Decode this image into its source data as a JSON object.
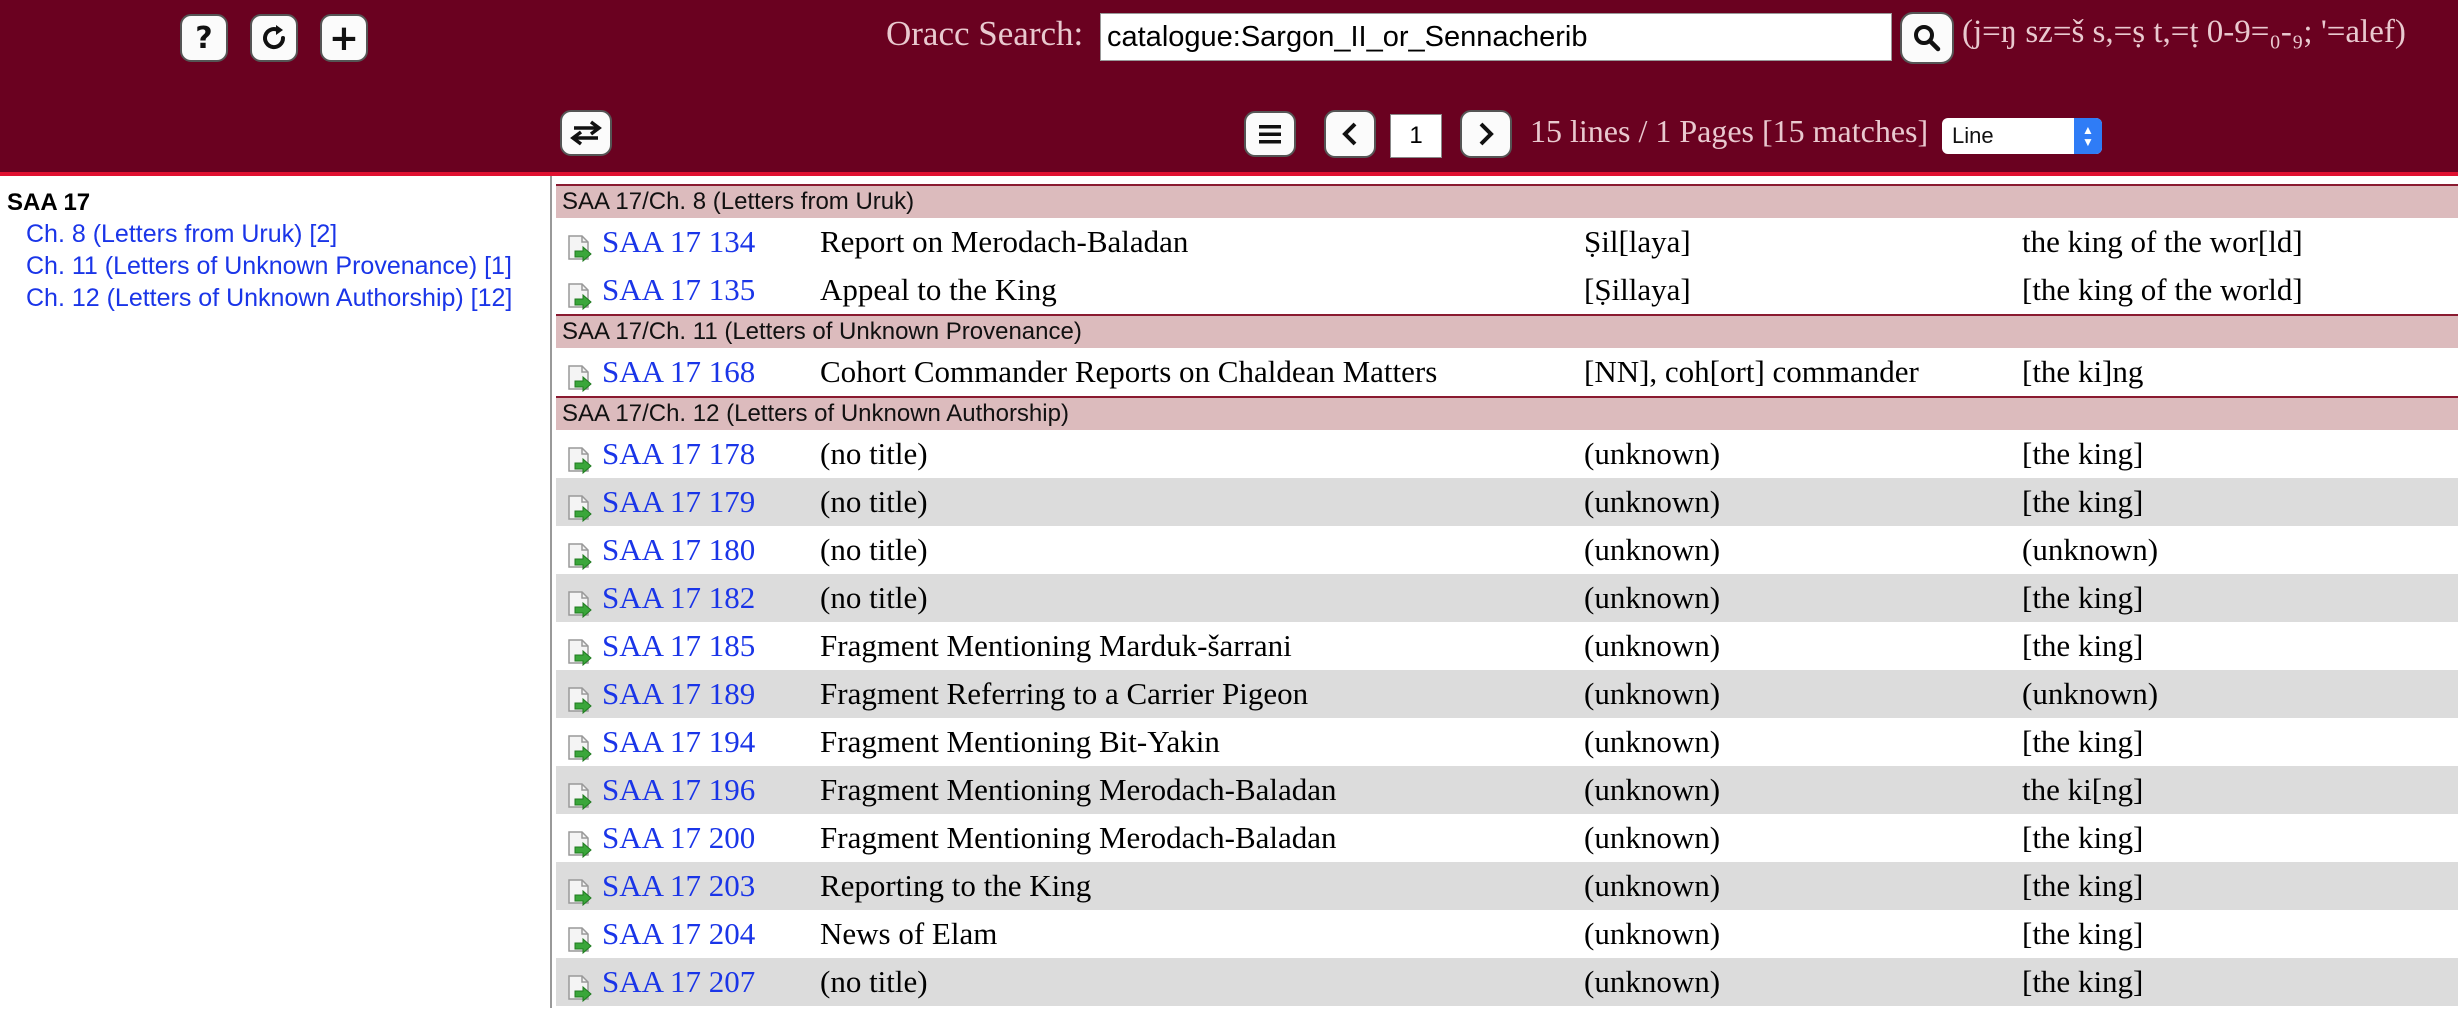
{
  "toolbar": {
    "help_label": "?",
    "add_label": "+"
  },
  "search": {
    "label": "Oracc Search:",
    "value": "catalogue:Sargon_II_or_Sennacherib"
  },
  "legend": {
    "p1": "(j=ŋ",
    "p2": "sz=š",
    "p3": "s,=ṣ",
    "p4": "t,=ṭ",
    "p5": "0-9=₀-₉;",
    "p6": "'=alef)"
  },
  "pager": {
    "page": "1",
    "summary": "15 lines / 1 Pages [15 matches]",
    "mode": "Line"
  },
  "sidebar": {
    "title": "SAA 17",
    "items": [
      {
        "label": "Ch. 8 (Letters from Uruk) [2]"
      },
      {
        "label": "Ch. 11 (Letters of Unknown Provenance) [1]"
      },
      {
        "label": "Ch. 12 (Letters of Unknown Authorship) [12]"
      }
    ]
  },
  "results": {
    "groups": [
      {
        "header": "SAA 17/Ch. 8 (Letters from Uruk)",
        "rows": [
          {
            "id": "SAA 17 134",
            "title": "Report on Merodach-Baladan",
            "author": "Ṣil[laya]",
            "addressee": "the king of the wor[ld]"
          },
          {
            "id": "SAA 17 135",
            "title": "Appeal to the King",
            "author": "[Ṣillaya]",
            "addressee": "[the king of the world]"
          }
        ]
      },
      {
        "header": "SAA 17/Ch. 11 (Letters of Unknown Provenance)",
        "rows": [
          {
            "id": "SAA 17 168",
            "title": "Cohort Commander Reports on Chaldean Matters",
            "author": "[NN], coh[ort] commander",
            "addressee": "[the ki]ng"
          }
        ]
      },
      {
        "header": "SAA 17/Ch. 12 (Letters of Unknown Authorship)",
        "rows": [
          {
            "id": "SAA 17 178",
            "title": "(no title)",
            "author": "(unknown)",
            "addressee": "[the king]"
          },
          {
            "id": "SAA 17 179",
            "title": "(no title)",
            "author": "(unknown)",
            "addressee": "[the king]"
          },
          {
            "id": "SAA 17 180",
            "title": "(no title)",
            "author": "(unknown)",
            "addressee": "(unknown)"
          },
          {
            "id": "SAA 17 182",
            "title": "(no title)",
            "author": "(unknown)",
            "addressee": "[the king]"
          },
          {
            "id": "SAA 17 185",
            "title": "Fragment Mentioning Marduk-šarrani",
            "author": "(unknown)",
            "addressee": "[the king]"
          },
          {
            "id": "SAA 17 189",
            "title": "Fragment Referring to a Carrier Pigeon",
            "author": "(unknown)",
            "addressee": "(unknown)"
          },
          {
            "id": "SAA 17 194",
            "title": "Fragment Mentioning Bit-Yakin",
            "author": "(unknown)",
            "addressee": "[the king]"
          },
          {
            "id": "SAA 17 196",
            "title": "Fragment Mentioning Merodach-Baladan",
            "author": "(unknown)",
            "addressee": "the ki[ng]"
          },
          {
            "id": "SAA 17 200",
            "title": "Fragment Mentioning Merodach-Baladan",
            "author": "(unknown)",
            "addressee": "[the king]"
          },
          {
            "id": "SAA 17 203",
            "title": "Reporting to the King",
            "author": "(unknown)",
            "addressee": "[the king]"
          },
          {
            "id": "SAA 17 204",
            "title": "News of Elam",
            "author": "(unknown)",
            "addressee": "[the king]"
          },
          {
            "id": "SAA 17 207",
            "title": "(no title)",
            "author": "(unknown)",
            "addressee": "[the king]"
          }
        ]
      }
    ]
  }
}
